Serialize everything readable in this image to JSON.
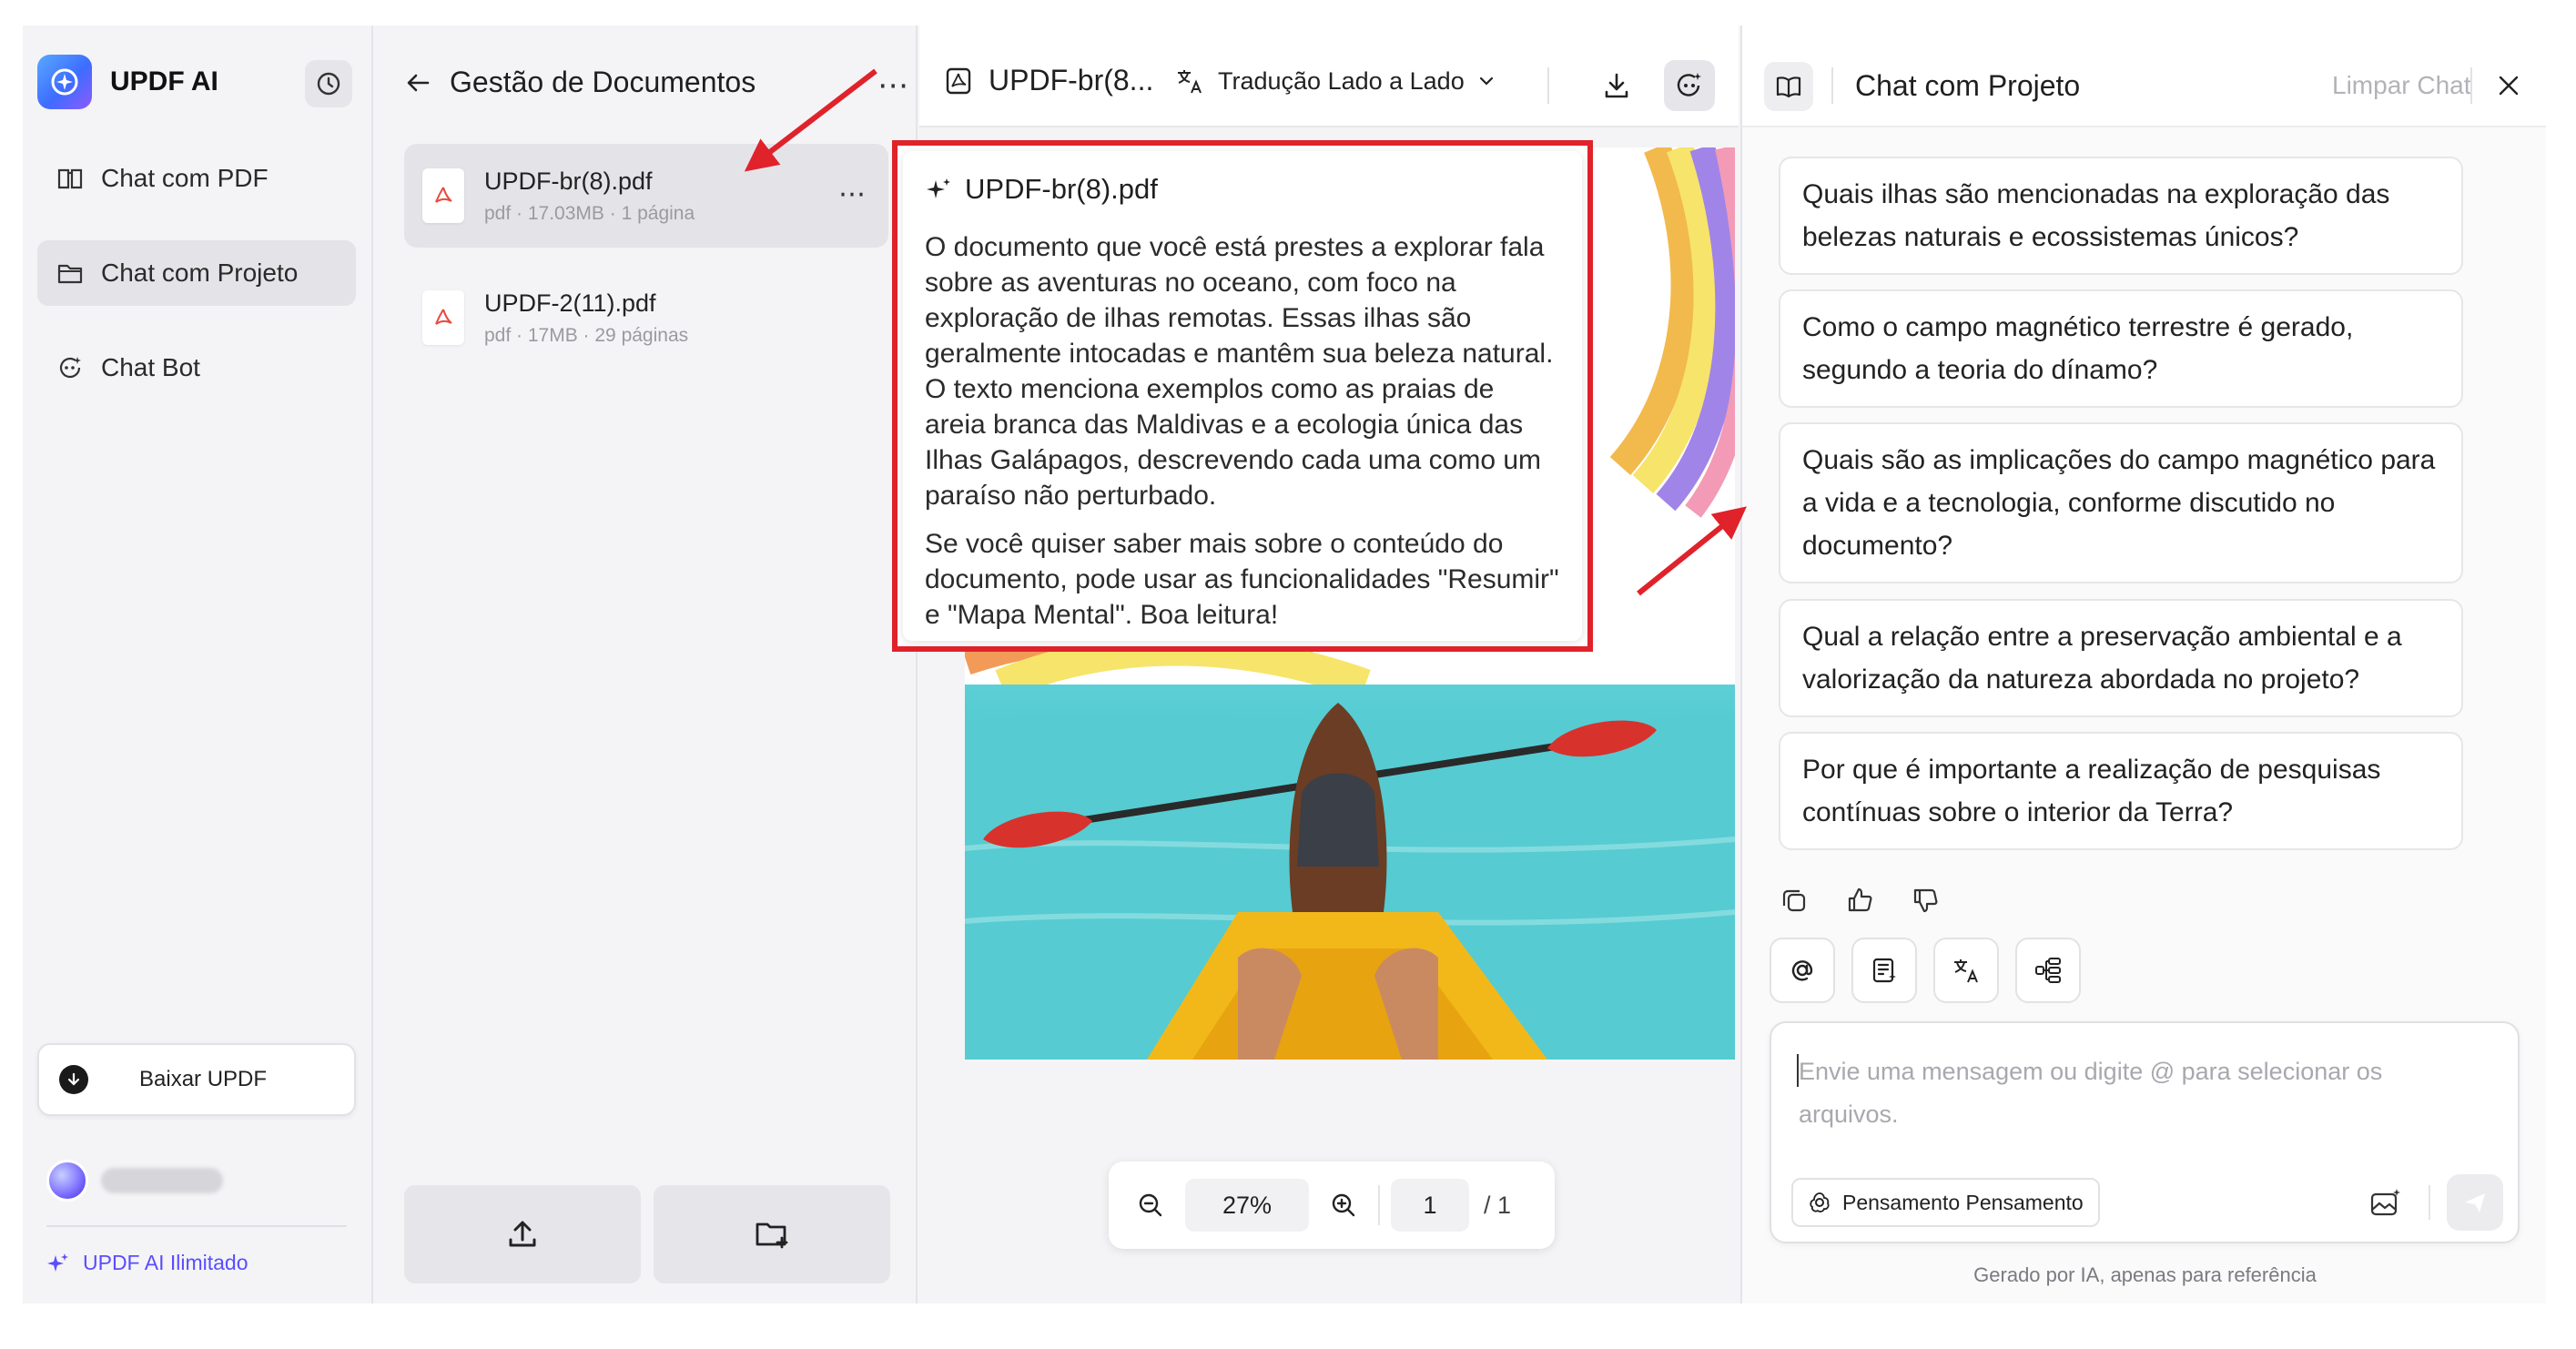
{
  "sidebar": {
    "brand": "UPDF AI",
    "nav": [
      {
        "label": "Chat com PDF",
        "icon": "book-chat-icon"
      },
      {
        "label": "Chat com Projeto",
        "icon": "folder-chat-icon",
        "active": true
      },
      {
        "label": "Chat Bot",
        "icon": "bot-icon"
      }
    ],
    "download_label": "Baixar UPDF",
    "plan_label": "UPDF AI Ilimitado"
  },
  "docs": {
    "title": "Gestão de Documentos",
    "files": [
      {
        "name": "UPDF-br(8).pdf",
        "meta": "pdf · 17.03MB · 1 página",
        "active": true
      },
      {
        "name": "UPDF-2(11).pdf",
        "meta": "pdf · 17MB · 29 páginas"
      }
    ]
  },
  "viewer": {
    "file_title": "UPDF-br(8...",
    "translate_label": "Tradução Lado a Lado",
    "zoom": "27%",
    "page": "1",
    "total_pages": "/ 1"
  },
  "summary": {
    "title": "UPDF-br(8).pdf",
    "p1": "O documento que você está prestes a explorar fala sobre as aventuras no oceano, com foco na exploração de ilhas remotas. Essas ilhas são geralmente intocadas e mantêm sua beleza natural. O texto menciona exemplos como as praias de areia branca das Maldivas e a ecologia única das Ilhas Galápagos, descrevendo cada uma como um paraíso não perturbado.",
    "p2": "Se você quiser saber mais sobre o conteúdo do documento, pode usar as funcionalidades \"Resumir\" e \"Mapa Mental\". Boa leitura!"
  },
  "chat": {
    "title": "Chat com Projeto",
    "clear_label": "Limpar Chat",
    "questions": [
      "Quais ilhas são mencionadas na exploração das belezas naturais e ecossistemas únicos?",
      "Como o campo magnético terrestre é gerado, segundo a teoria do dínamo?",
      "Quais são as implicações do campo magnético para a vida e a tecnologia, conforme discutido no documento?",
      "Qual a relação entre a preservação ambiental e a valorização da natureza abordada no projeto?",
      "Por que é importante a realização de pesquisas contínuas sobre o interior da Terra?"
    ],
    "input_placeholder": "Envie uma mensagem ou digite @ para selecionar os arquivos.",
    "think_label": "Pensamento Pensamento",
    "disclaimer": "Gerado por IA, apenas para referência"
  },
  "colors": {
    "accent": "#5b4dff",
    "annotation": "#e0222b",
    "kayak": "#f2b81a"
  }
}
